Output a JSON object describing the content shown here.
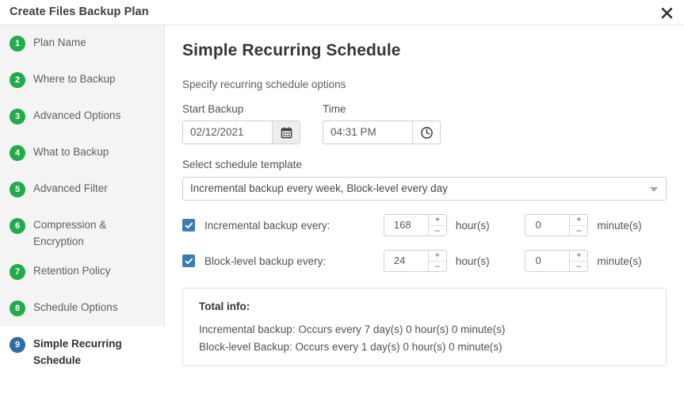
{
  "window": {
    "title": "Create Files Backup Plan",
    "close_icon": "close-icon"
  },
  "sidebar": {
    "items": [
      {
        "number": "1",
        "label": "Plan Name",
        "active": false
      },
      {
        "number": "2",
        "label": "Where to Backup",
        "active": false
      },
      {
        "number": "3",
        "label": "Advanced Options",
        "active": false
      },
      {
        "number": "4",
        "label": "What to Backup",
        "active": false
      },
      {
        "number": "5",
        "label": "Advanced Filter",
        "active": false
      },
      {
        "number": "6",
        "label": "Compression & Encryption",
        "active": false
      },
      {
        "number": "7",
        "label": "Retention Policy",
        "active": false
      },
      {
        "number": "8",
        "label": "Schedule Options",
        "active": false
      },
      {
        "number": "9",
        "label": "Simple Recurring Schedule",
        "active": true
      }
    ],
    "step_color": "#22ab4b",
    "active_step_color": "#2e6da4"
  },
  "main": {
    "title": "Simple Recurring Schedule",
    "subtitle": "Specify recurring schedule options",
    "start_backup": {
      "label": "Start Backup",
      "value": "02/12/2021",
      "icon": "calendar-icon"
    },
    "time": {
      "label": "Time",
      "value": "04:31 PM",
      "icon": "clock-icon"
    },
    "schedule_template": {
      "label": "Select schedule template",
      "value": "Incremental backup every week, Block-level every day",
      "caret_icon": "chevron-down-icon"
    },
    "incremental": {
      "checked": true,
      "label": "Incremental backup every:",
      "hours": "168",
      "hours_unit": "hour(s)",
      "minutes": "0",
      "minutes_unit": "minute(s)"
    },
    "block_level": {
      "checked": true,
      "label": "Block-level backup every:",
      "hours": "24",
      "hours_unit": "hour(s)",
      "minutes": "0",
      "minutes_unit": "minute(s)"
    },
    "total_info": {
      "title": "Total info:",
      "lines": [
        "Incremental backup: Occurs every 7 day(s) 0 hour(s) 0 minute(s)",
        "Block-level Backup: Occurs every 1 day(s) 0 hour(s) 0 minute(s)"
      ]
    },
    "spinner": {
      "increment_label": "+",
      "decrement_label": "–"
    }
  }
}
